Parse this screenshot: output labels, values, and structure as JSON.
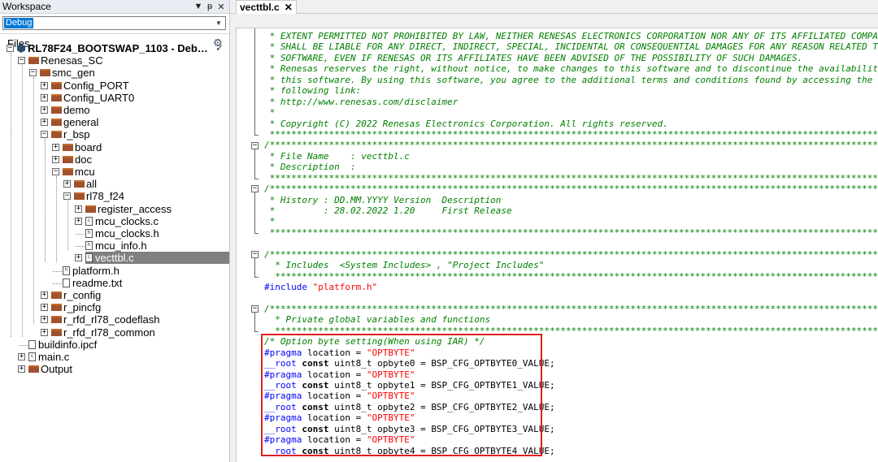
{
  "workspace": {
    "title": "Workspace",
    "config": "Debug",
    "files_header": "Files",
    "tree": [
      {
        "label": "RL78F24_BOOTSWAP_1103 - Deb…",
        "kind": "project",
        "toggle": "⊟",
        "bold": true
      },
      {
        "label": "Renesas_SC",
        "kind": "folder",
        "toggle": "⊟"
      },
      {
        "label": "smc_gen",
        "kind": "folder",
        "toggle": "⊟"
      },
      {
        "label": "Config_PORT",
        "kind": "folder",
        "toggle": "⊞"
      },
      {
        "label": "Config_UART0",
        "kind": "folder",
        "toggle": "⊞"
      },
      {
        "label": "demo",
        "kind": "folder",
        "toggle": "⊞"
      },
      {
        "label": "general",
        "kind": "folder",
        "toggle": "⊞"
      },
      {
        "label": "r_bsp",
        "kind": "folder",
        "toggle": "⊟"
      },
      {
        "label": "board",
        "kind": "folder",
        "toggle": "⊞"
      },
      {
        "label": "doc",
        "kind": "folder",
        "toggle": "⊞"
      },
      {
        "label": "mcu",
        "kind": "folder",
        "toggle": "⊟"
      },
      {
        "label": "all",
        "kind": "folder",
        "toggle": "⊞"
      },
      {
        "label": "rl78_f24",
        "kind": "folder",
        "toggle": "⊟"
      },
      {
        "label": "register_access",
        "kind": "folder",
        "toggle": "⊞"
      },
      {
        "label": "mcu_clocks.c",
        "kind": "cfile",
        "toggle": "⊞"
      },
      {
        "label": "mcu_clocks.h",
        "kind": "hfile",
        "toggle": ""
      },
      {
        "label": "mcu_info.h",
        "kind": "hfile",
        "toggle": ""
      },
      {
        "label": "vecttbl.c",
        "kind": "cfile",
        "toggle": "⊞",
        "selected": true
      },
      {
        "label": "platform.h",
        "kind": "hfile",
        "toggle": ""
      },
      {
        "label": "readme.txt",
        "kind": "txtfile",
        "toggle": ""
      },
      {
        "label": "r_config",
        "kind": "folder",
        "toggle": "⊞"
      },
      {
        "label": "r_pincfg",
        "kind": "folder",
        "toggle": "⊞"
      },
      {
        "label": "r_rfd_rl78_codeflash",
        "kind": "folder",
        "toggle": "⊞"
      },
      {
        "label": "r_rfd_rl78_common",
        "kind": "folder",
        "toggle": "⊞"
      },
      {
        "label": "buildinfo.ipcf",
        "kind": "file",
        "toggle": ""
      },
      {
        "label": "main.c",
        "kind": "cfile",
        "toggle": "⊞"
      },
      {
        "label": "Output",
        "kind": "folder",
        "toggle": "⊞"
      }
    ]
  },
  "editor": {
    "tab_label": "vecttbl.c",
    "lines": [
      [
        {
          "t": " * EXTENT PERMITTED NOT PROHIBITED BY LAW, NEITHER RENESAS ELECTRONICS CORPORATION NOR ANY OF ITS AFFILIATED COMPANIES",
          "c": "c"
        }
      ],
      [
        {
          "t": " * SHALL BE LIABLE FOR ANY DIRECT, INDIRECT, SPECIAL, INCIDENTAL OR CONSEQUENTIAL DAMAGES FOR ANY REASON RELATED TO THIS",
          "c": "c"
        }
      ],
      [
        {
          "t": " * SOFTWARE, EVEN IF RENESAS OR ITS AFFILIATES HAVE BEEN ADVISED OF THE POSSIBILITY OF SUCH DAMAGES.",
          "c": "c"
        }
      ],
      [
        {
          "t": " * Renesas reserves the right, without notice, to make changes to this software and to discontinue the availability of",
          "c": "c"
        }
      ],
      [
        {
          "t": " * this software. By using this software, you agree to the additional terms and conditions found by accessing the",
          "c": "c"
        }
      ],
      [
        {
          "t": " * following link:",
          "c": "c"
        }
      ],
      [
        {
          "t": " * http://www.renesas.com/disclaimer",
          "c": "c"
        }
      ],
      [
        {
          "t": " *",
          "c": "c"
        }
      ],
      [
        {
          "t": " * Copyright (C) 2022 Renesas Electronics Corporation. All rights reserved.",
          "c": "c"
        }
      ],
      [
        {
          "t": " ***********************************************************************************************************************/",
          "c": "c"
        }
      ],
      [
        {
          "t": "/***********************************************************************************************************************",
          "c": "c"
        }
      ],
      [
        {
          "t": " * File Name    : vecttbl.c",
          "c": "c"
        }
      ],
      [
        {
          "t": " * Description  :",
          "c": "c"
        }
      ],
      [
        {
          "t": " ***********************************************************************************************************************/",
          "c": "c"
        }
      ],
      [
        {
          "t": "/***********************************************************************************************************************",
          "c": "c"
        }
      ],
      [
        {
          "t": " * History : DD.MM.YYYY Version  Description",
          "c": "c"
        }
      ],
      [
        {
          "t": " *         : 28.02.2022 1.20     First Release",
          "c": "c"
        }
      ],
      [
        {
          "t": " *",
          "c": "c"
        }
      ],
      [
        {
          "t": " ***********************************************************************************************************************/",
          "c": "c"
        }
      ],
      [
        {
          "t": "",
          "c": "pl"
        }
      ],
      [
        {
          "t": "/***********************************************************************************************************************",
          "c": "c"
        }
      ],
      [
        {
          "t": "  * Includes  <System Includes> , \"Project Includes\"",
          "c": "c"
        }
      ],
      [
        {
          "t": "  ***********************************************************************************************************************/",
          "c": "c"
        }
      ],
      [
        {
          "t": "#include ",
          "c": "pre"
        },
        {
          "t": "\"platform.h\"",
          "c": "s"
        }
      ],
      [
        {
          "t": "",
          "c": "pl"
        }
      ],
      [
        {
          "t": "/***********************************************************************************************************************",
          "c": "c"
        }
      ],
      [
        {
          "t": "  * Private global variables and functions",
          "c": "c"
        }
      ],
      [
        {
          "t": "  ***********************************************************************************************************************/",
          "c": "c"
        }
      ],
      [
        {
          "t": "/* Option byte setting(When using IAR) */",
          "c": "c"
        }
      ],
      [
        {
          "t": "#pragma",
          "c": "pre"
        },
        {
          "t": " location = ",
          "c": "pl"
        },
        {
          "t": "\"OPTBYTE\"",
          "c": "s"
        }
      ],
      [
        {
          "t": "__root ",
          "c": "kw"
        },
        {
          "t": "const",
          "c": "b"
        },
        {
          "t": " uint8_t opbyte0 = BSP_CFG_OPTBYTE0_VALUE;",
          "c": "pl"
        }
      ],
      [
        {
          "t": "#pragma",
          "c": "pre"
        },
        {
          "t": " location = ",
          "c": "pl"
        },
        {
          "t": "\"OPTBYTE\"",
          "c": "s"
        }
      ],
      [
        {
          "t": "__root ",
          "c": "kw"
        },
        {
          "t": "const",
          "c": "b"
        },
        {
          "t": " uint8_t opbyte1 = BSP_CFG_OPTBYTE1_VALUE;",
          "c": "pl"
        }
      ],
      [
        {
          "t": "#pragma",
          "c": "pre"
        },
        {
          "t": " location = ",
          "c": "pl"
        },
        {
          "t": "\"OPTBYTE\"",
          "c": "s"
        }
      ],
      [
        {
          "t": "__root ",
          "c": "kw"
        },
        {
          "t": "const",
          "c": "b"
        },
        {
          "t": " uint8_t opbyte2 = BSP_CFG_OPTBYTE2_VALUE;",
          "c": "pl"
        }
      ],
      [
        {
          "t": "#pragma",
          "c": "pre"
        },
        {
          "t": " location = ",
          "c": "pl"
        },
        {
          "t": "\"OPTBYTE\"",
          "c": "s"
        }
      ],
      [
        {
          "t": "__root ",
          "c": "kw"
        },
        {
          "t": "const",
          "c": "b"
        },
        {
          "t": " uint8_t opbyte3 = BSP_CFG_OPTBYTE3_VALUE;",
          "c": "pl"
        }
      ],
      [
        {
          "t": "#pragma",
          "c": "pre"
        },
        {
          "t": " location = ",
          "c": "pl"
        },
        {
          "t": "\"OPTBYTE\"",
          "c": "s"
        }
      ],
      [
        {
          "t": "__root ",
          "c": "kw"
        },
        {
          "t": "const",
          "c": "b"
        },
        {
          "t": " uint8_t opbyte4 = BSP_CFG_OPTBYTE4_VALUE;",
          "c": "pl"
        }
      ]
    ]
  },
  "highlight_color": "#e0201e"
}
